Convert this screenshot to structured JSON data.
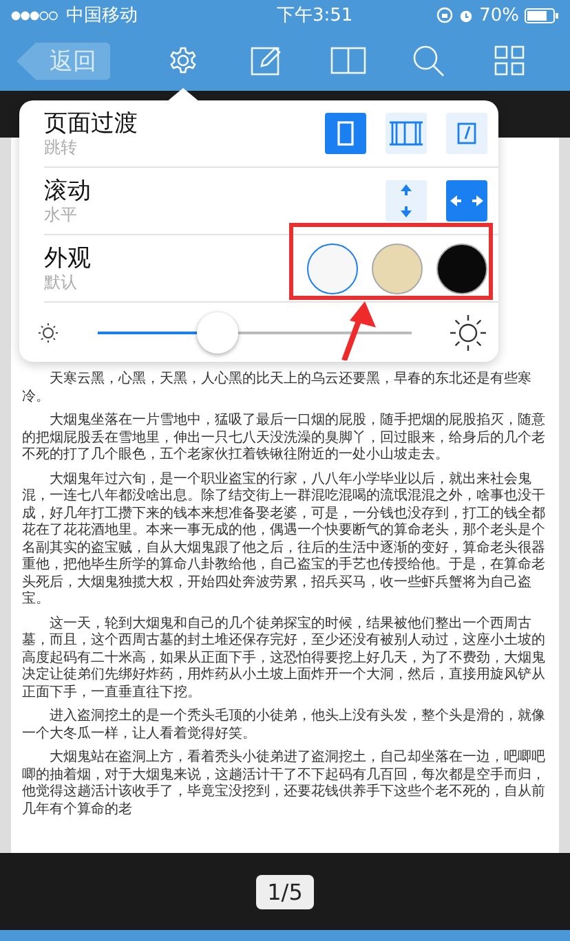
{
  "status_bar": {
    "carrier": "中国移动",
    "time": "下午3:51",
    "battery": "70%"
  },
  "toolbar": {
    "back": "返回",
    "tools": [
      {
        "kind": "settings",
        "selected": true
      },
      {
        "kind": "edit",
        "selected": false
      },
      {
        "kind": "book",
        "selected": false
      },
      {
        "kind": "search",
        "selected": false
      },
      {
        "kind": "grid",
        "selected": false
      }
    ]
  },
  "settings_popover": {
    "rows": [
      {
        "kind": "transition",
        "title": "页面过渡",
        "subtitle": "跳转",
        "options": [
          {
            "kind": "single",
            "selected": true
          },
          {
            "kind": "slide",
            "selected": false
          },
          {
            "kind": "curl",
            "selected": false
          }
        ]
      },
      {
        "kind": "scroll",
        "title": "滚动",
        "subtitle": "水平",
        "options": [
          {
            "kind": "vertical",
            "selected": false
          },
          {
            "kind": "horizontal",
            "selected": true
          }
        ]
      },
      {
        "kind": "appearance",
        "title": "外观",
        "subtitle": "默认",
        "options": [
          {
            "color": "#f7f7f7",
            "selected": true
          },
          {
            "color": "#e8d9b0",
            "selected": false
          },
          {
            "color": "#0a0a0a",
            "selected": false
          }
        ]
      }
    ],
    "brightness": {
      "level": 0.38
    }
  },
  "page": {
    "paragraphs": [
      "天寒云黑，心黑，天黑，人心黑的比天上的乌云还要黑，早春的东北还是有些寒冷。",
      "大烟鬼坐落在一片雪地中，猛吸了最后一口烟的屁股，随手把烟的屁股掐灭，随意的把烟屁股丢在雪地里，伸出一只七八天没洗澡的臭脚丫，回过眼来，给身后的几个老不死的打了几个眼色，五个老家伙扛着铁锹往附近的一处小山坡走去。",
      "大烟鬼年过六旬，是一个职业盗宝的行家，八八年小学毕业以后，就出来社会鬼混，一连七八年都没啥出息。除了结交街上一群混吃混喝的流氓混混之外，啥事也没干成，好几年打工攒下来的钱本来想准备娶老婆，可是，一分钱也没存到，打工的钱全都花在了花花酒地里。本来一事无成的他，偶遇一个快要断气的算命老头，那个老头是个名副其实的盗宝贼，自从大烟鬼跟了他之后，往后的生活中逐渐的变好，算命老头很器重他，把他毕生所学的算命八卦教给他，自己盗宝的手艺也传授给他。于是，在算命老头死后，大烟鬼独揽大权，开始四处奔波劳累，招兵买马，收一些虾兵蟹将为自己盗宝。",
      "这一天，轮到大烟鬼和自己的几个徒弟探宝的时候，结果被他们整出一个西周古墓，而且，这个西周古墓的封土堆还保存完好，至少还没有被别人动过，这座小土坡的高度起码有二十米高，如果从正面下手，这恐怕得要挖上好几天，为了不费劲，大烟鬼决定让徒弟们先绑好炸药，用炸药从小土坡上面炸开一个大洞，然后，直接用旋风铲从正面下手，一直垂直往下挖。",
      "进入盗洞挖土的是一个秃头毛顶的小徒弟，他头上没有头发，整个头是滑的，就像一个大冬瓜一样，让人看着觉得好笑。",
      "大烟鬼站在盗洞上方，看着秃头小徒弟进了盗洞挖土，自己却坐落在一边，吧唧吧唧的抽着烟，对于大烟鬼来说，这趟活计干了不下起码有几百回，每次都是空手而归，他觉得这趟活计该收手了，毕竟宝没挖到，还要花钱供养手下这些个老不死的，自从前几年有个算命的老"
    ]
  },
  "pager": {
    "label": "1/5"
  }
}
